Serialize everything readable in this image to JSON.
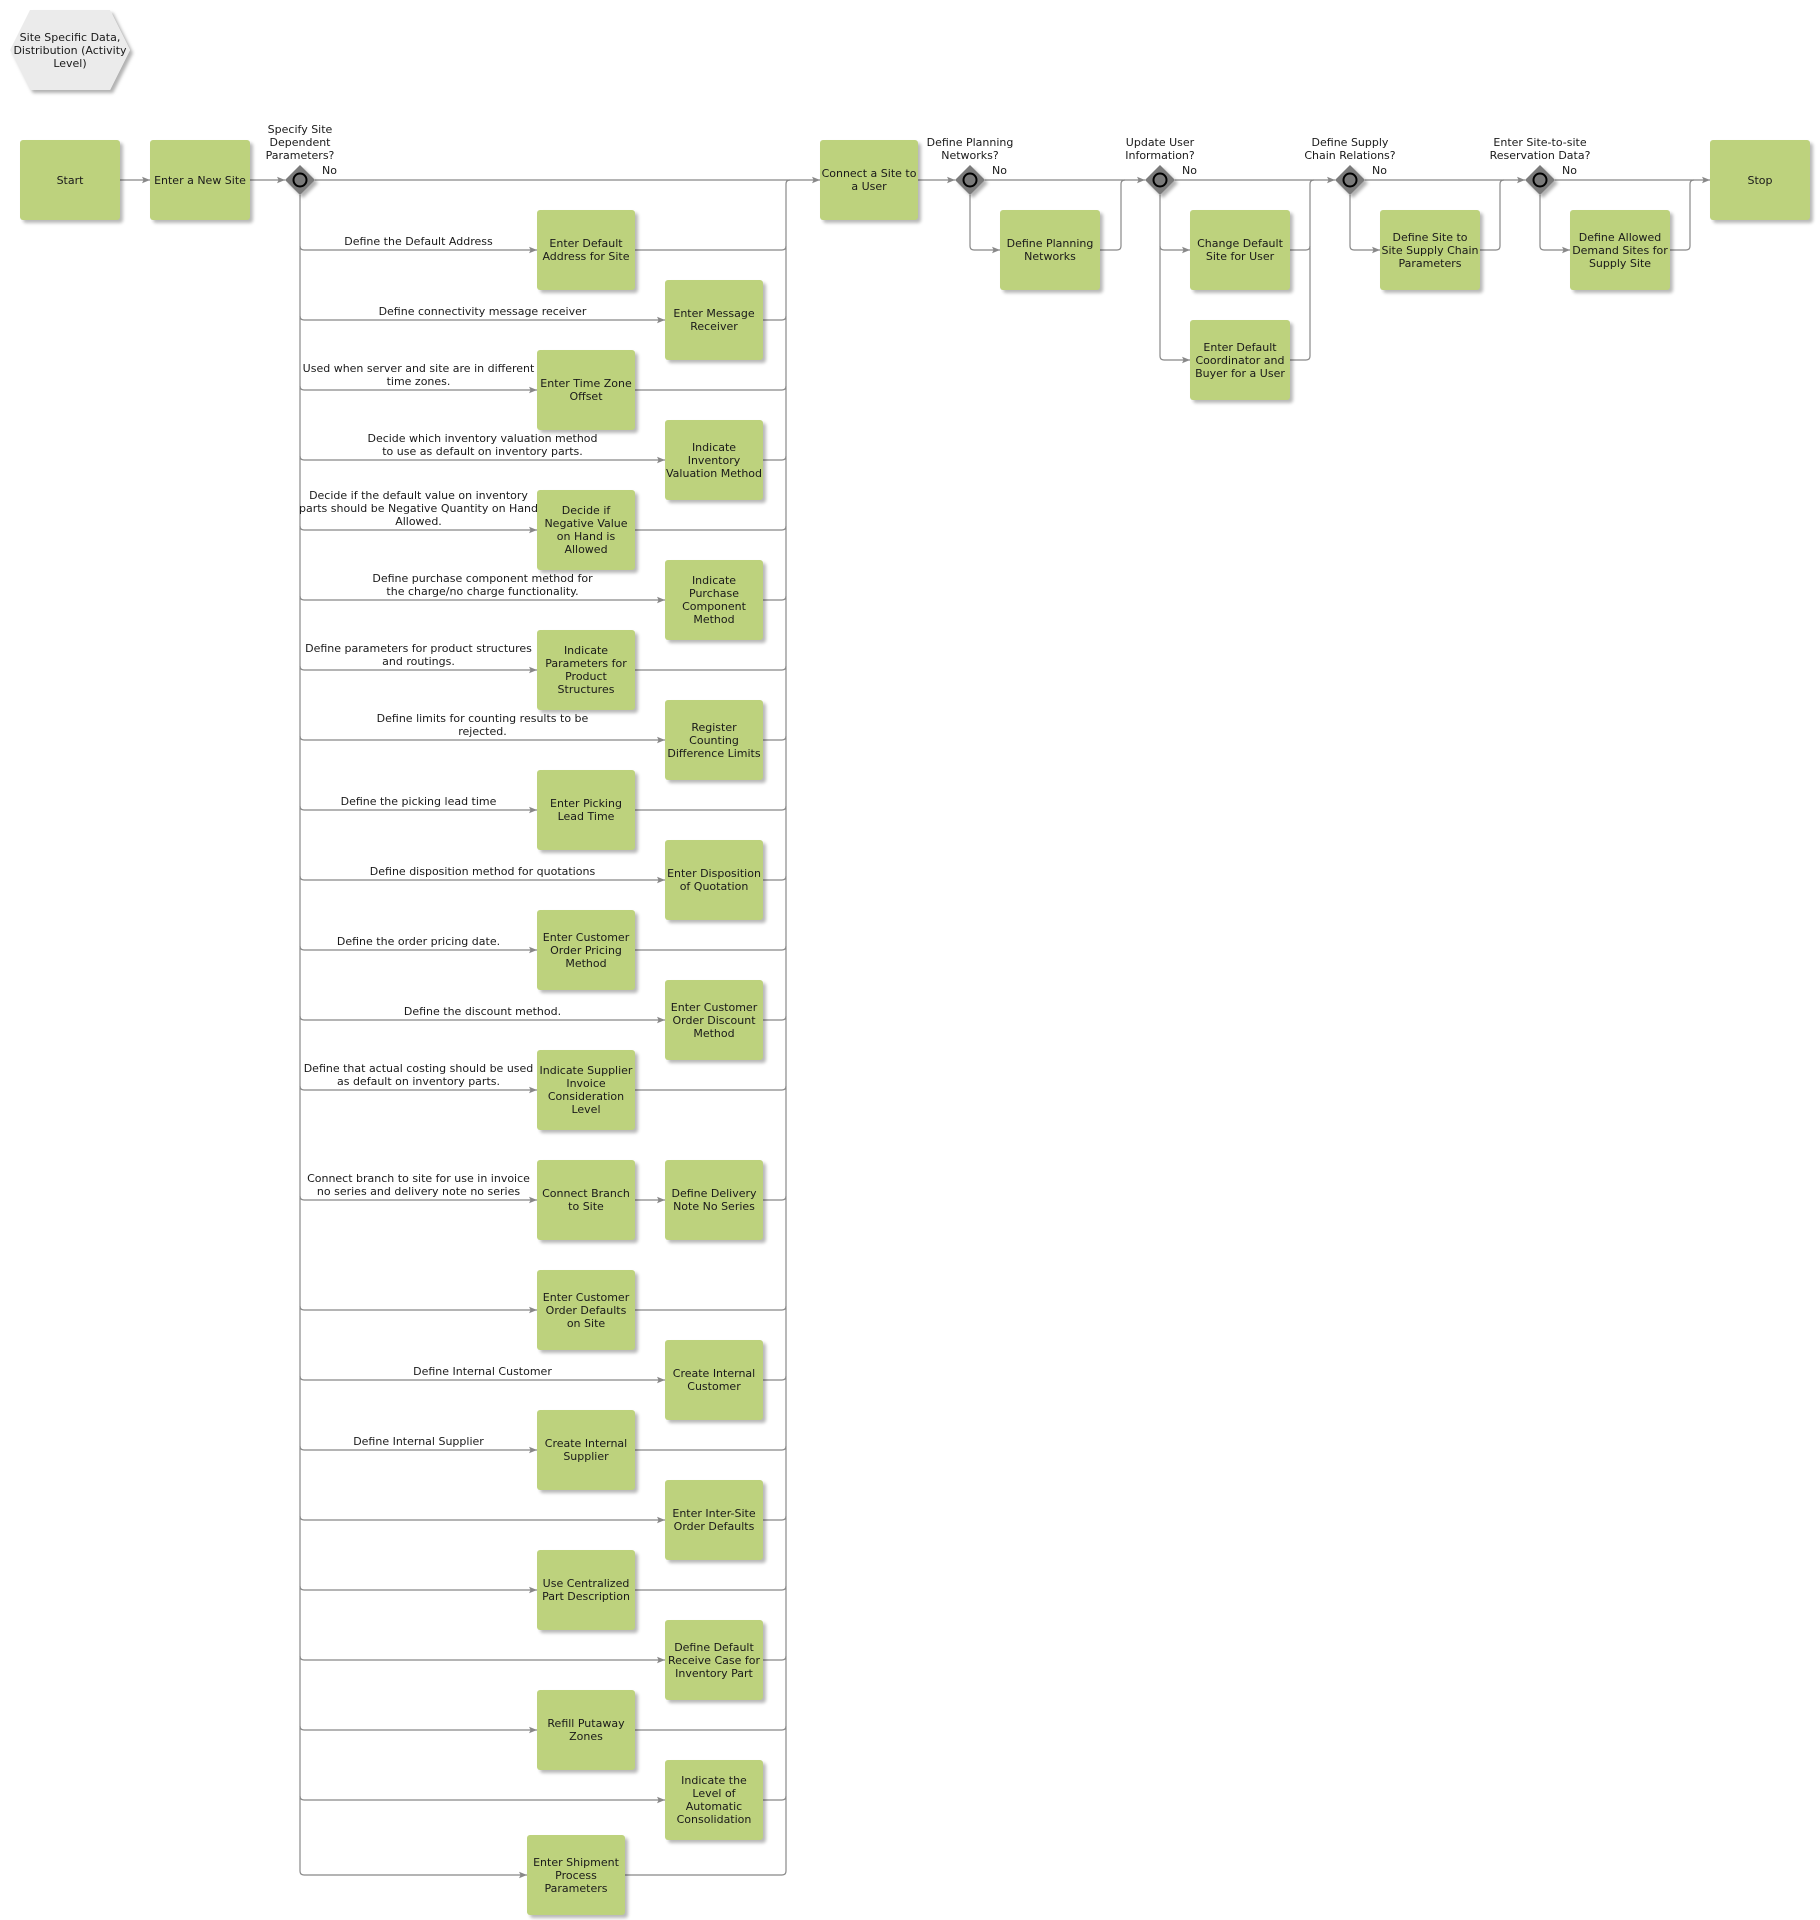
{
  "title": "Site Specific Data, Distribution (Activity Level)",
  "colors": {
    "task": "#bdd27d",
    "title_shape": "#ebebeb",
    "gateway": "#7a7a7a",
    "line": "#808080"
  },
  "start": "Start",
  "stop": "Stop",
  "enter_new_site": "Enter a New Site",
  "connect_site_user": "Connect a Site to a User",
  "gateways": [
    {
      "question": "Specify Site Dependent Parameters?",
      "no": "No"
    },
    {
      "question": "Define Planning Networks?",
      "no": "No"
    },
    {
      "question": "Update User Information?",
      "no": "No"
    },
    {
      "question": "Define Supply Chain Relations?",
      "no": "No"
    },
    {
      "question": "Enter Site-to-site Reservation Data?",
      "no": "No"
    }
  ],
  "site_params": [
    {
      "label": "Define the Default Address",
      "tasks": [
        "Enter Default Address for Site"
      ],
      "col": 0
    },
    {
      "label": "Define connectivity message receiver",
      "tasks": [
        "Enter Message Receiver"
      ],
      "col": 1
    },
    {
      "label": "Used when server and site are in different time zones.",
      "tasks": [
        "Enter Time Zone Offset"
      ],
      "col": 0
    },
    {
      "label": "Decide which inventory valuation method to use as default on inventory parts.",
      "tasks": [
        "Indicate Inventory Valuation Method"
      ],
      "col": 1
    },
    {
      "label": "Decide if the default value on inventory parts should be Negative Quantity on Hand Allowed.",
      "tasks": [
        "Decide if Negative Value on Hand is Allowed"
      ],
      "col": 0
    },
    {
      "label": "Define purchase component method for the charge/no charge functionality.",
      "tasks": [
        "Indicate Purchase Component Method"
      ],
      "col": 1
    },
    {
      "label": "Define parameters for product structures and routings.",
      "tasks": [
        "Indicate Parameters for Product Structures"
      ],
      "col": 0
    },
    {
      "label": "Define limits for counting results to be rejected.",
      "tasks": [
        "Register Counting Difference Limits"
      ],
      "col": 1
    },
    {
      "label": "Define the picking lead time",
      "tasks": [
        "Enter Picking Lead Time"
      ],
      "col": 0
    },
    {
      "label": "Define disposition method for quotations",
      "tasks": [
        "Enter Disposition of Quotation"
      ],
      "col": 1
    },
    {
      "label": "Define the order pricing date.",
      "tasks": [
        "Enter Customer Order Pricing Method"
      ],
      "col": 0
    },
    {
      "label": "Define the discount method.",
      "tasks": [
        "Enter Customer Order Discount Method"
      ],
      "col": 1
    },
    {
      "label": "Define that actual costing should be used as default on inventory parts.",
      "tasks": [
        "Indicate Supplier Invoice Consideration Level"
      ],
      "col": 0
    },
    {
      "label": "Connect branch to site for use in invoice no series and delivery note no series",
      "tasks": [
        "Connect Branch to Site",
        "Define Delivery Note No Series"
      ],
      "col": 0
    },
    {
      "label": "",
      "tasks": [
        "Enter Customer Order Defaults on Site"
      ],
      "col": 0
    },
    {
      "label": "Define Internal Customer",
      "tasks": [
        "Create Internal Customer"
      ],
      "col": 1
    },
    {
      "label": "Define Internal Supplier",
      "tasks": [
        "Create Internal Supplier"
      ],
      "col": 0
    },
    {
      "label": "",
      "tasks": [
        "Enter Inter-Site Order Defaults"
      ],
      "col": 1
    },
    {
      "label": "",
      "tasks": [
        "Use Centralized Part Description"
      ],
      "col": 0
    },
    {
      "label": "",
      "tasks": [
        "Define Default Receive Case for Inventory Part"
      ],
      "col": 1
    },
    {
      "label": "",
      "tasks": [
        "Refill Putaway Zones"
      ],
      "col": 0
    },
    {
      "label": "",
      "tasks": [
        "Indicate the Level of Automatic Consolidation"
      ],
      "col": 1
    },
    {
      "label": "",
      "tasks": [
        "Enter Shipment Process Parameters"
      ],
      "col": 0
    }
  ],
  "planning_tasks": [
    "Define Planning Networks"
  ],
  "user_tasks": [
    "Change Default Site for User",
    "Enter Default Coordinator and Buyer for a User"
  ],
  "supply_chain_tasks": [
    "Define Site to Site Supply Chain Parameters"
  ],
  "reservation_tasks": [
    "Define Allowed Demand Sites for Supply Site"
  ]
}
